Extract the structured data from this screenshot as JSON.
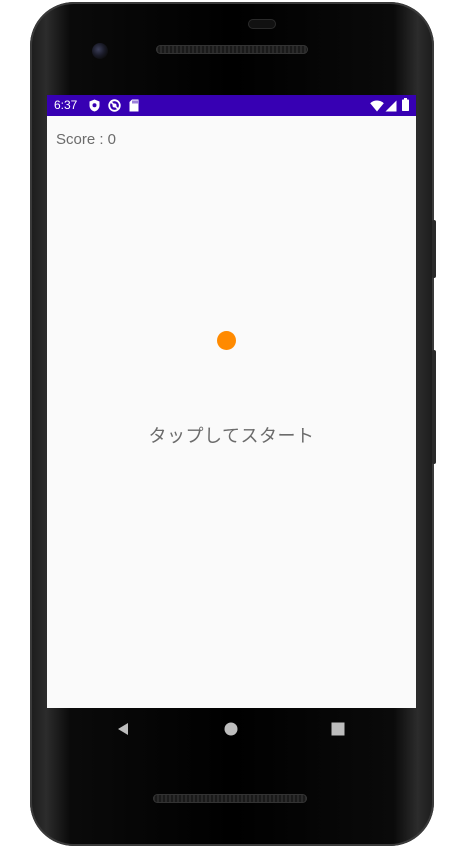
{
  "status_bar": {
    "time": "6:37",
    "background_color": "#3700b3",
    "left_icons": [
      "shield-icon",
      "do-not-disturb-icon",
      "sd-card-icon"
    ],
    "right_icons": [
      "wifi-icon",
      "cell-signal-icon",
      "battery-icon"
    ]
  },
  "game": {
    "score_text": "Score : 0",
    "start_prompt": "タップしてスタート",
    "ball_color": "#ff8a00"
  },
  "nav_bar": {
    "buttons": [
      "back-icon",
      "home-icon",
      "recents-icon"
    ]
  }
}
